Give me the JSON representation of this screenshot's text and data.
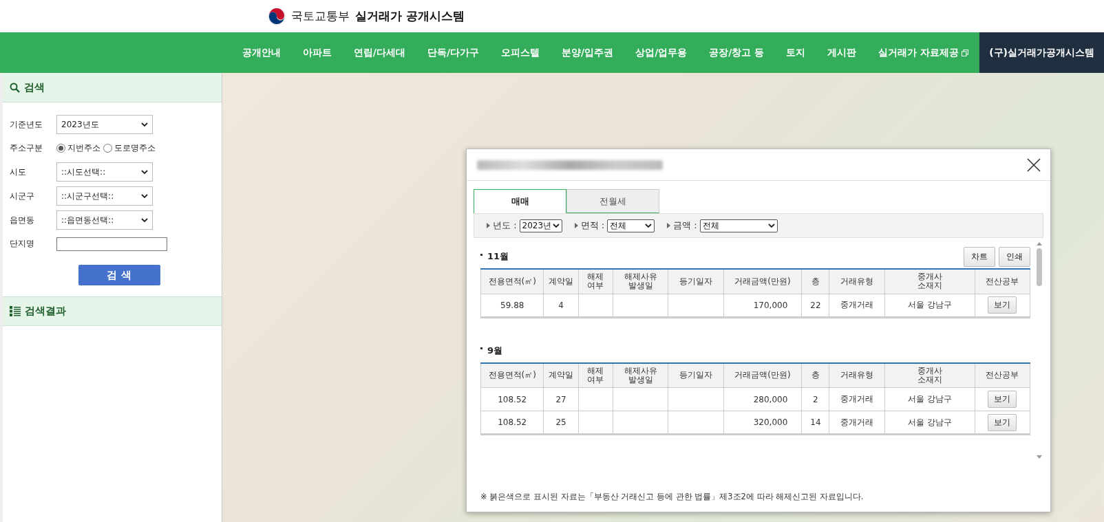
{
  "header": {
    "ministry": "국토교통부",
    "system": "실거래가 공개시스템"
  },
  "nav": [
    {
      "label": "공개안내",
      "external": false,
      "kind": "normal"
    },
    {
      "label": "아파트",
      "external": false,
      "kind": "normal"
    },
    {
      "label": "연립/다세대",
      "external": false,
      "kind": "normal"
    },
    {
      "label": "단독/다가구",
      "external": false,
      "kind": "normal"
    },
    {
      "label": "오피스텔",
      "external": false,
      "kind": "normal"
    },
    {
      "label": "분양/입주권",
      "external": false,
      "kind": "normal"
    },
    {
      "label": "상업/업무용",
      "external": false,
      "kind": "normal"
    },
    {
      "label": "공장/창고 등",
      "external": false,
      "kind": "normal"
    },
    {
      "label": "토지",
      "external": false,
      "kind": "normal"
    },
    {
      "label": "게시판",
      "external": false,
      "kind": "normal"
    },
    {
      "label": "실거래가 자료제공",
      "external": true,
      "kind": "normal"
    },
    {
      "label": "(구)실거래가공개시스템",
      "external": false,
      "kind": "dark"
    }
  ],
  "sidebar": {
    "search_title": "검색",
    "fields": [
      {
        "label": "기준년도",
        "kind": "select",
        "value": "2023년도"
      },
      {
        "label": "주소구분",
        "kind": "radio",
        "options": [
          {
            "label": "지번주소",
            "selected": true
          },
          {
            "label": "도로명주소",
            "selected": false
          }
        ]
      },
      {
        "label": "시도",
        "kind": "select",
        "value": "::시도선택::"
      },
      {
        "label": "시군구",
        "kind": "select",
        "value": "::시군구선택::"
      },
      {
        "label": "읍면동",
        "kind": "select",
        "value": "::읍면동선택::"
      },
      {
        "label": "단지명",
        "kind": "text"
      }
    ],
    "search_button": "검 색",
    "results_title": "검색결과"
  },
  "dialog": {
    "tabs": [
      {
        "label": "매매",
        "selected": true
      },
      {
        "label": "전월세",
        "selected": false
      }
    ],
    "filters": [
      {
        "label": "년도 :",
        "value": "2023년"
      },
      {
        "label": "면적 :",
        "value": "전체"
      },
      {
        "label": "금액 :",
        "value": "전체"
      }
    ],
    "buttons": [
      "차트",
      "인쇄"
    ],
    "sections": [
      {
        "month": "11월",
        "columns": [
          "전용면적(㎡)",
          "계약일",
          "해제\n여부",
          "해제사유\n발생일",
          "등기일자",
          "거래금액(만원)",
          "층",
          "거래유형",
          "중개사\n소재지",
          "전산공부"
        ],
        "rows": [
          [
            "59.88",
            "4",
            "",
            "",
            "",
            "170,000",
            "22",
            "중개거래",
            "서울 강남구",
            "보기"
          ]
        ]
      },
      {
        "month": "9월",
        "columns": [
          "전용면적(㎡)",
          "계약일",
          "해제\n여부",
          "해제사유\n발생일",
          "등기일자",
          "거래금액(만원)",
          "층",
          "거래유형",
          "중개사\n소재지",
          "전산공부"
        ],
        "rows": [
          [
            "108.52",
            "27",
            "",
            "",
            "",
            "280,000",
            "2",
            "중개거래",
            "서울 강남구",
            "보기"
          ],
          [
            "108.52",
            "25",
            "",
            "",
            "",
            "320,000",
            "14",
            "중개거래",
            "서울 강남구",
            "보기"
          ]
        ]
      }
    ],
    "note": "※ 붉은색으로 표시된 자료는「부동산 거래신고 등에 관한 법률」제3조2에 따라 해제신고된 자료입니다."
  }
}
